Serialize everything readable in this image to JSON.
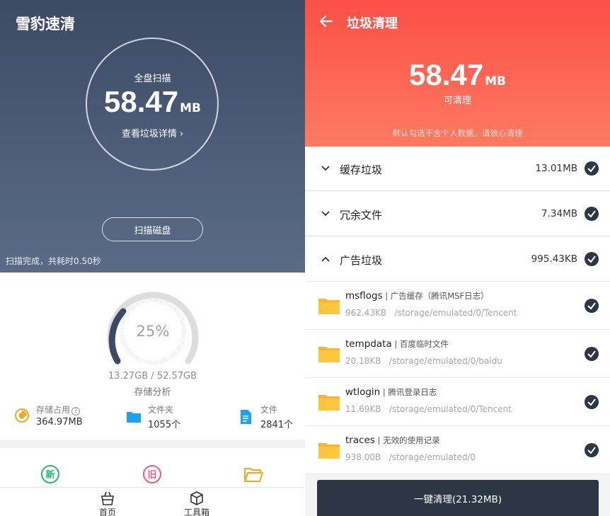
{
  "left": {
    "app_title": "雪豹速清",
    "scan": {
      "label": "全盘扫描",
      "size_value": "58.47",
      "size_unit": "MB",
      "detail_link": "查看垃圾详情",
      "button": "扫描磁盘",
      "status": "扫描完成，共耗时0.50秒"
    },
    "storage": {
      "percent": "25%",
      "percent_value": 25,
      "used_total": "13.27GB / 52.57GB",
      "label": "存储分析"
    },
    "stats": [
      {
        "title": "存储占用",
        "value": "364.97MB",
        "icon": "pie-chart-icon"
      },
      {
        "title": "文件夹",
        "value": "1055个",
        "icon": "folder-icon"
      },
      {
        "title": "文件",
        "value": "2841个",
        "icon": "document-icon"
      }
    ],
    "quick_icons": [
      "new-icon",
      "old-icon",
      "open-folder-icon"
    ],
    "quick_badges": {
      "new": "新",
      "old": "旧"
    },
    "nav": [
      {
        "label": "首页",
        "icon": "basket-icon"
      },
      {
        "label": "工具箱",
        "icon": "cube-icon"
      }
    ]
  },
  "right": {
    "title": "垃圾清理",
    "total_value": "58.47",
    "total_unit": "MB",
    "total_caption": "可清理",
    "note": "默认勾选不含个人数据，请放心清理",
    "categories": [
      {
        "name": "缓存垃圾",
        "size": "13.01MB",
        "expanded": false
      },
      {
        "name": "冗余文件",
        "size": "7.34MB",
        "expanded": false
      },
      {
        "name": "广告垃圾",
        "size": "995.43KB",
        "expanded": true
      }
    ],
    "files": [
      {
        "name": "msflogs",
        "desc": "广告缓存（腾讯MSF日志）",
        "size": "962.43KB",
        "path": "/storage/emulated/0/Tencent"
      },
      {
        "name": "tempdata",
        "desc": "百度临时文件",
        "size": "20.18KB",
        "path": "/storage/emulated/0/baidu"
      },
      {
        "name": "wtlogin",
        "desc": "腾讯登录日志",
        "size": "11.69KB",
        "path": "/storage/emulated/0/Tencent"
      },
      {
        "name": "traces",
        "desc": "无效的使用记录",
        "size": "938.00B",
        "path": "/storage/emulated/0"
      }
    ],
    "clean_button": "一键清理(21.32MB)"
  },
  "colors": {
    "hero_dark": "#3c4a63",
    "hero_red": "#fb4f47",
    "button_dark": "#2c3645",
    "folder_yellow": "#fbb528",
    "stat_orange": "#f5a623",
    "stat_blue": "#1aa3f0",
    "badge_green": "#2bb673",
    "badge_pink": "#ef5a8a"
  }
}
